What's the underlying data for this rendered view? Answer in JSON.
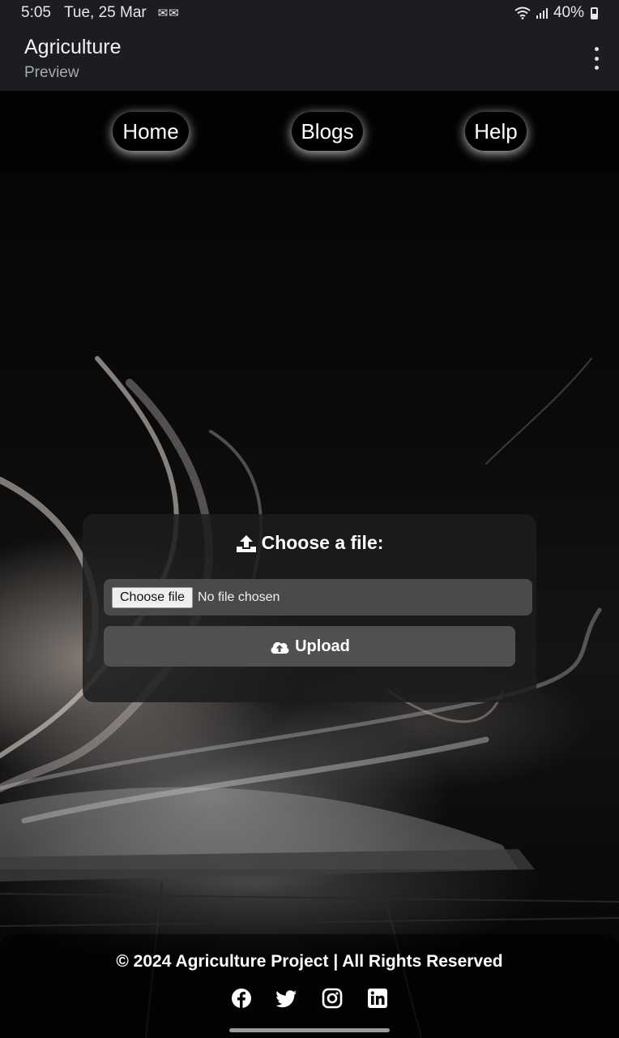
{
  "status_bar": {
    "time": "5:05",
    "date": "Tue, 25 Mar",
    "battery": "40%"
  },
  "app_bar": {
    "title": "Agriculture",
    "subtitle": "Preview"
  },
  "nav": {
    "items": [
      {
        "label": "Home"
      },
      {
        "label": "Blogs"
      },
      {
        "label": "Help"
      }
    ]
  },
  "upload": {
    "heading": "Choose a file:",
    "choose_button": "Choose file",
    "file_status": "No file chosen",
    "upload_button": "Upload"
  },
  "footer": {
    "copyright": "© 2024 Agriculture Project | All Rights Reserved",
    "socials": [
      "facebook-icon",
      "twitter-icon",
      "instagram-icon",
      "linkedin-icon"
    ]
  }
}
